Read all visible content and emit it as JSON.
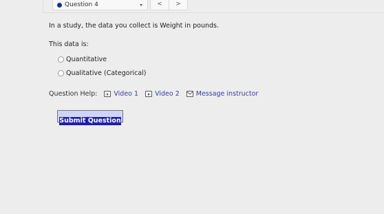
{
  "topbar": {
    "question_label": "Question 4",
    "pager_prev": "<",
    "pager_next": ">"
  },
  "question": {
    "text": "In a study, the data you collect is Weight in pounds.",
    "subtext": "This data is:",
    "options": [
      {
        "label": "Quantitative",
        "selected": false
      },
      {
        "label": "Qualitative (Categorical)",
        "selected": false
      }
    ]
  },
  "help": {
    "label": "Question Help:",
    "links": [
      {
        "label": "Video 1",
        "icon": "play-video-icon"
      },
      {
        "label": "Video 2",
        "icon": "play-video-icon"
      },
      {
        "label": "Message instructor",
        "icon": "envelope-icon"
      }
    ]
  },
  "submit": {
    "label": "Submit Question"
  },
  "colors": {
    "accent": "#2020a8",
    "link": "#3a3aa8",
    "question_dot": "#1f2d9c"
  }
}
